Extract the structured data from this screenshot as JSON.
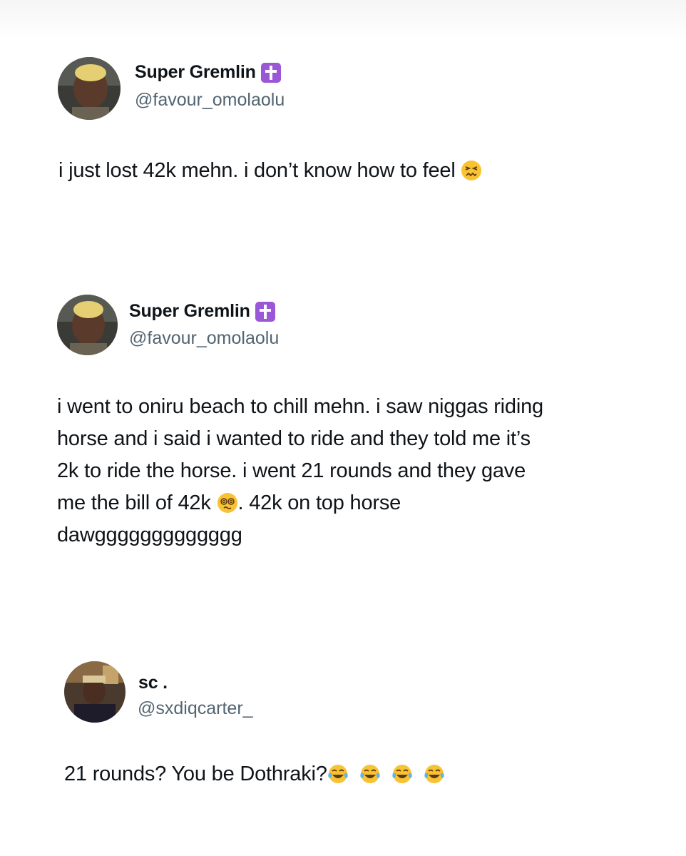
{
  "tweets": [
    {
      "display_name": "Super Gremlin",
      "badge_icon": "latin-cross-emoji",
      "handle": "@favour_omolaolu",
      "text": "i just lost 42k mehn. i don’t know how to feel",
      "trailing_emoji": "confounded-face-emoji"
    },
    {
      "display_name": "Super Gremlin",
      "badge_icon": "latin-cross-emoji",
      "handle": "@favour_omolaolu",
      "text_line1": "i went to oniru beach to chill mehn. i saw niggas riding",
      "text_line2": "horse and i said i wanted to ride and they told me it’s",
      "text_line3": "2k to ride the horse. i went 21 rounds and they gave",
      "text_line4a": "me the bill of 42k",
      "text_line4_emoji": "face-with-spiral-eyes-emoji",
      "text_line4b": ". 42k on top horse",
      "text_line5": "dawggggggggggggg"
    },
    {
      "display_name": "sc .",
      "handle": "@sxdiqcarter_",
      "text": "21 rounds?  You be Dothraki?",
      "trailing_emojis": [
        "face-with-tears-of-joy-emoji",
        "face-with-tears-of-joy-emoji",
        "face-with-tears-of-joy-emoji",
        "face-with-tears-of-joy-emoji"
      ]
    }
  ],
  "colors": {
    "text": "#0f1419",
    "handle": "#536471",
    "badge": "#9a57d6",
    "emoji_yellow": "#f9c233"
  }
}
